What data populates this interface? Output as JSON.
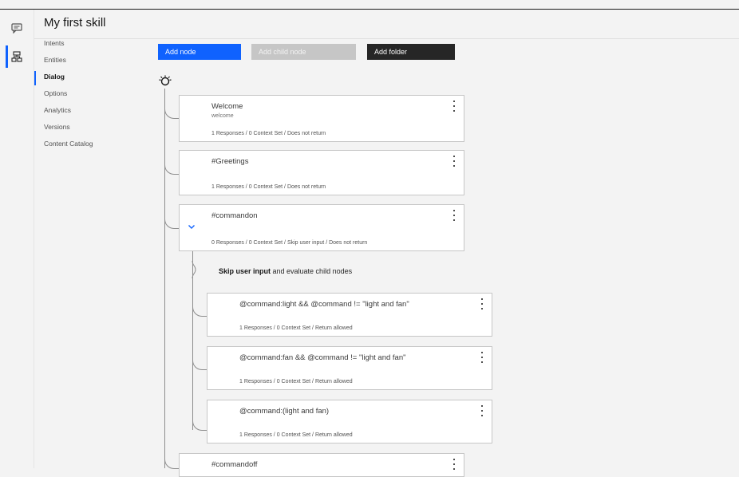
{
  "app": {
    "title": "My first skill"
  },
  "rail": {
    "items": [
      {
        "name": "assistants-icon",
        "active": false
      },
      {
        "name": "skills-icon",
        "active": true
      }
    ]
  },
  "sidebar": {
    "items": [
      {
        "label": "Intents"
      },
      {
        "label": "Entities"
      },
      {
        "label": "Dialog",
        "active": true
      },
      {
        "label": "Options"
      },
      {
        "label": "Analytics"
      },
      {
        "label": "Versions"
      },
      {
        "label": "Content Catalog"
      }
    ]
  },
  "toolbar": {
    "add_node": "Add node",
    "add_child_node": "Add child node",
    "add_folder": "Add folder"
  },
  "dialog": {
    "nodes": [
      {
        "title": "Welcome",
        "condition": "welcome",
        "status": "1 Responses / 0 Context Set / Does not return"
      },
      {
        "title": "#Greetings",
        "condition": "",
        "status": "1 Responses / 0 Context Set / Does not return"
      },
      {
        "title": "#commandon",
        "condition": "",
        "status": "0 Responses / 0 Context Set / Skip user input / Does not return",
        "expanded": true
      },
      {
        "title": "#commandoff",
        "condition": "",
        "status": ""
      }
    ],
    "skip_note": {
      "bold": "Skip user input",
      "rest": " and evaluate child nodes"
    },
    "children": [
      {
        "title": "@command:light && @command != \"light and fan\"",
        "status": "1 Responses / 0 Context Set / Return allowed"
      },
      {
        "title": "@command:fan && @command != \"light and fan\"",
        "status": "1 Responses / 0 Context Set / Return allowed"
      },
      {
        "title": "@command:(light and fan)",
        "status": "1 Responses / 0 Context Set / Return allowed"
      }
    ]
  },
  "colors": {
    "primary": "#0f62fe",
    "dark": "#262626",
    "disabled": "#c6c6c6"
  }
}
